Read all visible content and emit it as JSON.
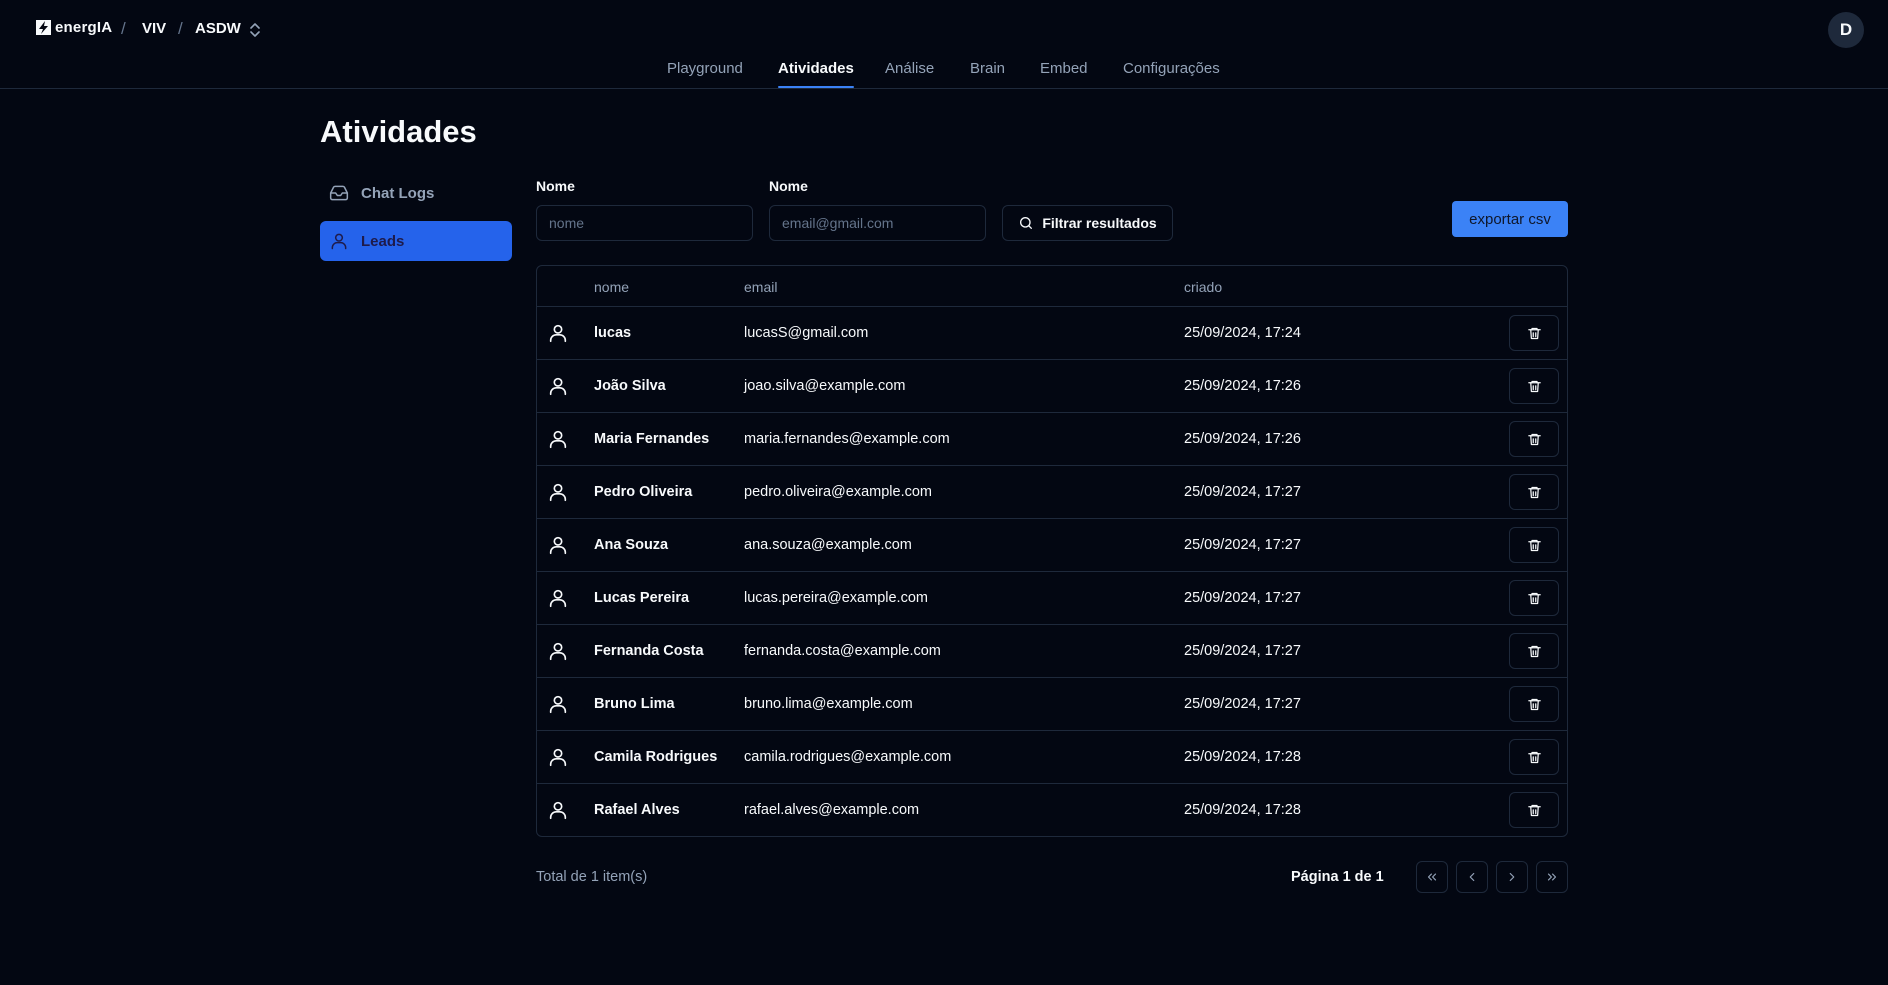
{
  "header": {
    "brand": "energIA",
    "breadcrumb": [
      "VIV",
      "ASDW"
    ],
    "avatar_initial": "D"
  },
  "tabs": [
    {
      "label": "Playground",
      "active": false
    },
    {
      "label": "Atividades",
      "active": true
    },
    {
      "label": "Análise",
      "active": false
    },
    {
      "label": "Brain",
      "active": false
    },
    {
      "label": "Embed",
      "active": false
    },
    {
      "label": "Configurações",
      "active": false
    }
  ],
  "page_title": "Atividades",
  "sidebar": {
    "items": [
      {
        "label": "Chat Logs",
        "icon": "inbox-icon",
        "active": false
      },
      {
        "label": "Leads",
        "icon": "user-icon",
        "active": true
      }
    ]
  },
  "filters": {
    "name_label": "Nome",
    "name_placeholder": "nome",
    "name_value": "",
    "email_label": "Nome",
    "email_placeholder": "email@gmail.com",
    "email_value": "",
    "filter_button": "Filtrar resultados",
    "export_button": "exportar csv"
  },
  "table": {
    "columns": [
      "nome",
      "email",
      "criado"
    ],
    "rows": [
      {
        "nome": "lucas",
        "email": "lucasS@gmail.com",
        "criado": "25/09/2024, 17:24"
      },
      {
        "nome": "João Silva",
        "email": "joao.silva@example.com",
        "criado": "25/09/2024, 17:26"
      },
      {
        "nome": "Maria Fernandes",
        "email": "maria.fernandes@example.com",
        "criado": "25/09/2024, 17:26"
      },
      {
        "nome": "Pedro Oliveira",
        "email": "pedro.oliveira@example.com",
        "criado": "25/09/2024, 17:27"
      },
      {
        "nome": "Ana Souza",
        "email": "ana.souza@example.com",
        "criado": "25/09/2024, 17:27"
      },
      {
        "nome": "Lucas Pereira",
        "email": "lucas.pereira@example.com",
        "criado": "25/09/2024, 17:27"
      },
      {
        "nome": "Fernanda Costa",
        "email": "fernanda.costa@example.com",
        "criado": "25/09/2024, 17:27"
      },
      {
        "nome": "Bruno Lima",
        "email": "bruno.lima@example.com",
        "criado": "25/09/2024, 17:27"
      },
      {
        "nome": "Camila Rodrigues",
        "email": "camila.rodrigues@example.com",
        "criado": "25/09/2024, 17:28"
      },
      {
        "nome": "Rafael Alves",
        "email": "rafael.alves@example.com",
        "criado": "25/09/2024, 17:28"
      }
    ]
  },
  "footer": {
    "total": "Total de 1 item(s)",
    "page_info": "Página 1 de 1"
  },
  "colors": {
    "background": "#030712",
    "accent": "#3b82f6",
    "border": "#1e293b",
    "muted": "#94a3b8"
  }
}
